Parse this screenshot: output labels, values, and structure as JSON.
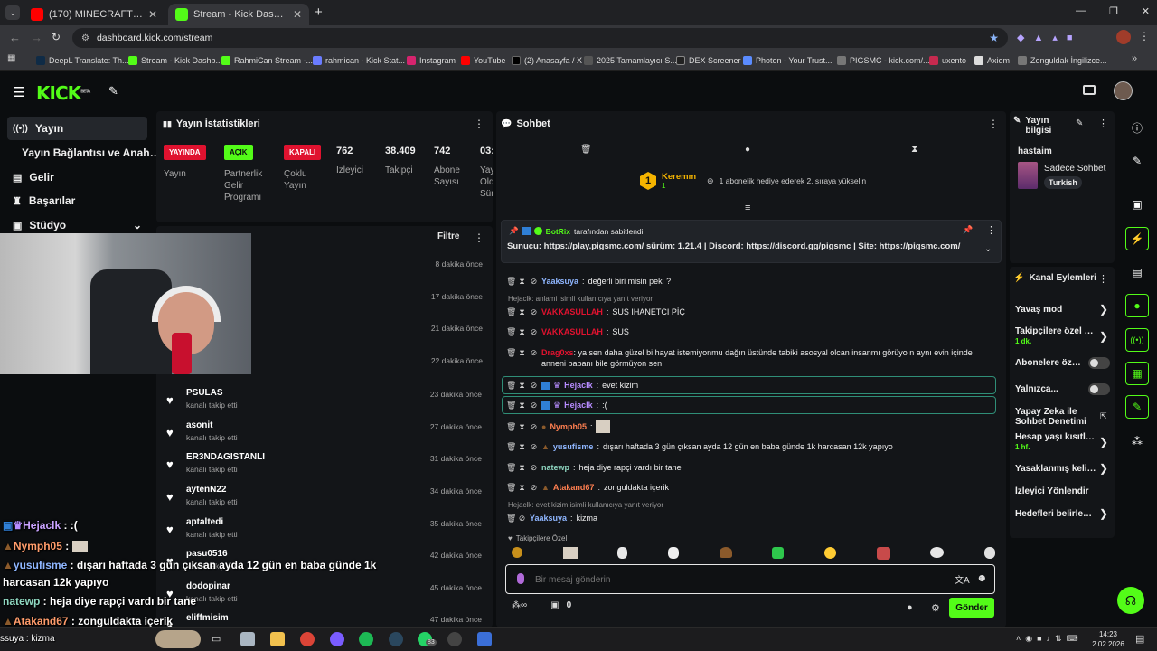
{
  "browser": {
    "tabs": [
      {
        "title": "(170) MINECRAFT'TA SAKLAMBAÇ",
        "icon": "youtube-icon"
      },
      {
        "title": "Stream - Kick Dashboard",
        "icon": "kick-icon"
      }
    ],
    "url": "dashboard.kick.com/stream",
    "bookmarks": [
      "DeepL Translate: Th...",
      "Stream - Kick Dashb...",
      "RahmiCan Stream -...",
      "rahmican - Kick Stat...",
      "Instagram",
      "YouTube",
      "(2) Anasayfa / X",
      "2025 Tamamlayıcı S...",
      "DEX Screener",
      "Photon - Your Trust...",
      "PIGSMC - kick.com/...",
      "uxento",
      "Axiom",
      "Zonguldak İngilizce..."
    ]
  },
  "kick": {
    "logo": "KICK",
    "beta": "BETA"
  },
  "nav": {
    "items": [
      "Yayın",
      "Yayın Bağlantısı ve Anahtarı",
      "Gelir",
      "Başarılar",
      "Stüdyo"
    ]
  },
  "stats": {
    "title": "Yayın İstatistikleri",
    "badges": [
      {
        "text": "YAYINDA",
        "label": "Yayın",
        "color": "#e0122f",
        "fg": "#ffffff"
      },
      {
        "text": "AÇIK",
        "label": "Partnerlik Gelir Programı",
        "color": "#53fc18",
        "fg": "#0b0d0f"
      },
      {
        "text": "KAPALI",
        "label": "Çoklu Yayın",
        "color": "#e0122f",
        "fg": "#ffffff"
      }
    ],
    "numbers": [
      {
        "value": "762",
        "label": "İzleyici"
      },
      {
        "value": "38.409",
        "label": "Takipçi"
      },
      {
        "value": "742",
        "label": "Abone Sayısı"
      },
      {
        "value": "03:",
        "label": "Yay Old Sür"
      }
    ]
  },
  "activity": {
    "filter": "Filtre",
    "times_top": [
      "8 dakika önce",
      "17 dakika önce",
      "21 dakika önce",
      "22 dakika önce"
    ],
    "followers": [
      {
        "name": "PSULAS",
        "action": "kanalı takip etti",
        "time": "23 dakika önce"
      },
      {
        "name": "asonit",
        "action": "kanalı takip etti",
        "time": "27 dakika önce"
      },
      {
        "name": "ER3NDAGISTANLI",
        "action": "kanalı takip etti",
        "time": "31 dakika önce"
      },
      {
        "name": "aytenN22",
        "action": "kanalı takip etti",
        "time": "34 dakika önce"
      },
      {
        "name": "aptaltedi",
        "action": "kanalı takip etti",
        "time": "35 dakika önce"
      },
      {
        "name": "pasu0516",
        "action": "kanalı takip etti",
        "time": "42 dakika önce"
      },
      {
        "name": "dodopinar",
        "action": "kanalı takip etti",
        "time": "45 dakika önce"
      },
      {
        "name": "eliffmisim",
        "action": "",
        "time": "47 dakika önce"
      }
    ]
  },
  "chat": {
    "title": "Sohbet",
    "top_gifter": {
      "name": "Keremm",
      "rank": "1",
      "count": "1",
      "note": "1 abonelik hediye ederek 2. sıraya yükselin"
    },
    "pinned": {
      "by": "BotRix",
      "by_suffix": "tarafından sabitlendi",
      "text_prefix": "Sunucu: ",
      "link1": "https://play.pigsmc.com/",
      "mid1": " sürüm: 1.21.4 | Discord: ",
      "link2": "https://discord.gg/pigsmc",
      "mid2": " | Site: ",
      "link3": "https://pigsmc.com/"
    },
    "messages": [
      {
        "user": "Yaaksuya",
        "text": "değerli biri misin peki ?",
        "color": "#8fb6ff"
      },
      {
        "reply": "Hejaclk: anlami isimli kullanıcıya yanıt veriyor"
      },
      {
        "user": "VAKKASULLAH",
        "text": "SUS IHANETCI PİÇ",
        "color": "#e0122f"
      },
      {
        "user": "VAKKASULLAH",
        "text": "SUS",
        "color": "#e0122f"
      },
      {
        "user": "Drag0xs",
        "text": "ya sen daha güzel bi hayat istemiyonmu dağın üstünde tabiki asosyal olcan insanmı görüyo n aynı evin içinde anneni babanı bile görmüyon sen",
        "color": "#e0122f"
      },
      {
        "user": "Hejaclk",
        "text": "evet kizim",
        "color": "#b78cff"
      },
      {
        "user": "Hejaclk",
        "text": ":(",
        "color": "#b78cff"
      },
      {
        "user": "Nymph05",
        "text": "",
        "color": "#ff7f50"
      },
      {
        "user": "yusufisme",
        "text": "dışarı haftada 3 gün çıksan ayda 12 gün en baba günde 1k harcasan 12k yapıyo",
        "color": "#8fb6ff"
      },
      {
        "user": "natewp",
        "text": "heja diye rapçi vardı bir tane",
        "color": "#8fd7c1"
      },
      {
        "user": "Atakand67",
        "text": "zonguldakta içerik",
        "color": "#ff7f50"
      },
      {
        "reply": "Hejaclk: evet kizim isimli kullanıcıya yanıt veriyor"
      },
      {
        "user": "Yaaksuya",
        "text": "kizma",
        "color": "#8fb6ff"
      }
    ],
    "followers_only": "Takipçilere Özel",
    "input_placeholder": "Bir mesaj gönderin",
    "count": "0",
    "send": "Gönder"
  },
  "info": {
    "title": "Yayın bilgisi",
    "stream_title": "hastaim",
    "category": "Sadece Sohbet",
    "language": "Turkish"
  },
  "actions": {
    "title": "Kanal Eylemleri",
    "items": [
      {
        "label": "Yavaş mod",
        "sub": "",
        "control": "chevron"
      },
      {
        "label": "Takipçilere özel soh",
        "sub": "1 dk.",
        "control": "chevron"
      },
      {
        "label": "Abonelere özel...",
        "sub": "",
        "control": "toggle"
      },
      {
        "label": "Yalnızca...",
        "sub": "",
        "control": "toggle"
      },
      {
        "label": "Yapay Zeka ile Sohbet Denetimi",
        "sub": "",
        "control": "external"
      },
      {
        "label": "Hesap yaşı kısıtlama",
        "sub": "1 hf.",
        "control": "chevron"
      },
      {
        "label": "Yasaklanmış kelimel",
        "sub": "",
        "control": "chevron"
      },
      {
        "label": "İzleyici Yönlendir",
        "sub": "",
        "control": "none"
      },
      {
        "label": "Hedefleri belirleyin",
        "sub": "",
        "control": "chevron"
      }
    ]
  },
  "overlay": {
    "lines": [
      {
        "user": "Hejaclk",
        "text": " : :(",
        "color": "#c9a2ff"
      },
      {
        "user": "Nymph05",
        "text": " : ",
        "color": "#ff9c6b"
      },
      {
        "user": "yusufisme",
        "text": " : dışarı haftada 3 gün çıksan ayda 12 gün en baba günde 1k",
        "color": "#8fb6ff"
      },
      {
        "user": "",
        "text": "harcasan 12k yapıyo",
        "color": "#ffffff"
      },
      {
        "user": "natewp",
        "text": " : heja diye rapçi vardı bir tane",
        "color": "#8fd7c1"
      },
      {
        "user": "Atakand67",
        "text": " : zonguldakta içerik",
        "color": "#ff9c6b"
      }
    ],
    "bottom": "ssuya : kizma"
  },
  "taskbar": {
    "time": "14:23",
    "date": "2.02.2026",
    "badge": "83"
  }
}
